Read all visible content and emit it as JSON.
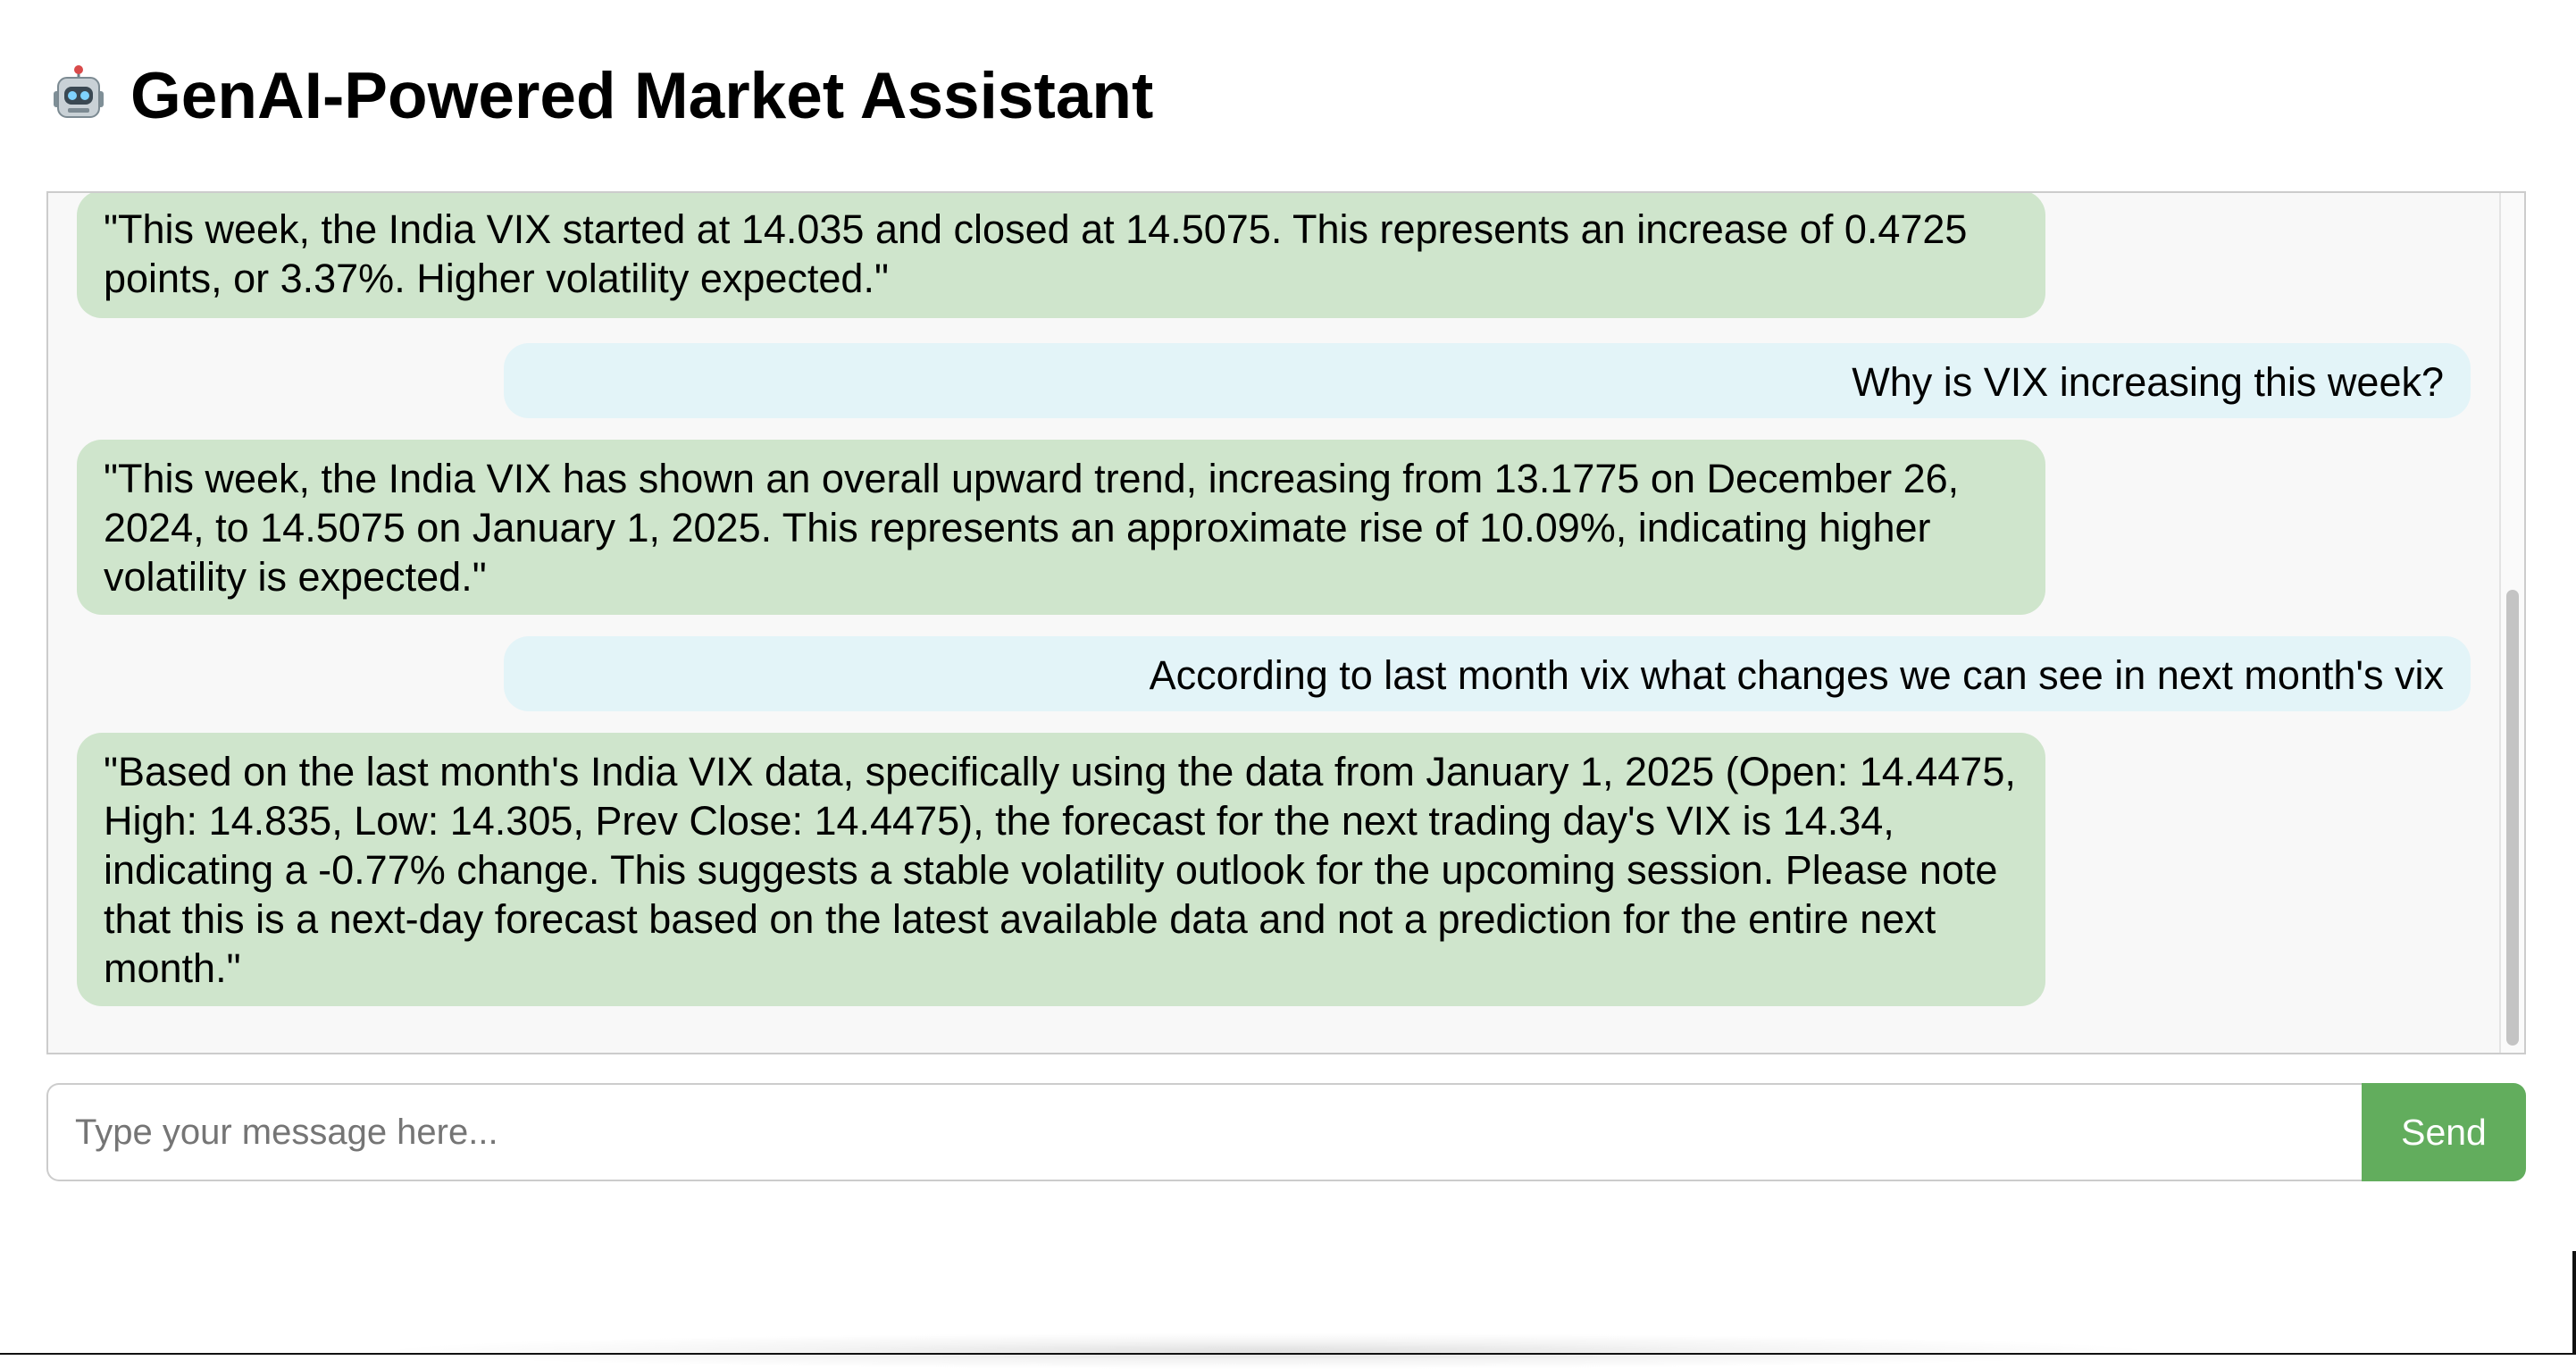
{
  "app": {
    "title": "GenAI-Powered Market Assistant",
    "title_icon": "robot-face-icon",
    "colors": {
      "page_background": "#ffffff",
      "chat_background": "#f8f8f8",
      "bot_message_background": "#cfe5cc",
      "user_message_background": "#e3f4f8",
      "send_button_background": "#62ad5d",
      "send_button_text": "#ffffff"
    }
  },
  "chat": {
    "messages": [
      {
        "role": "assistant",
        "text": "\"This week, the India VIX started at 14.035 and closed at 14.5075. This represents an increase of 0.4725 points, or 3.37%. Higher volatility expected.\""
      },
      {
        "role": "user",
        "text": "Why is VIX increasing this week?"
      },
      {
        "role": "assistant",
        "text": "\"This week, the India VIX has shown an overall upward trend, increasing from 13.1775 on December 26, 2024, to 14.5075 on January 1, 2025. This represents an approximate rise of 10.09%, indicating higher volatility is expected.\""
      },
      {
        "role": "user",
        "text": "According to last month vix what changes we can see in next month's vix"
      },
      {
        "role": "assistant",
        "text": "\"Based on the last month's India VIX data, specifically using the data from January 1, 2025 (Open: 14.4475, High: 14.835, Low: 14.305, Prev Close: 14.4475), the forecast for the next trading day's VIX is 14.34, indicating a -0.77% change. This suggests a stable volatility outlook for the upcoming session. Please note that this is a next-day forecast based on the latest available data and not a prediction for the entire next month.\""
      }
    ]
  },
  "composer": {
    "placeholder": "Type your message here...",
    "value": "",
    "send_label": "Send"
  }
}
